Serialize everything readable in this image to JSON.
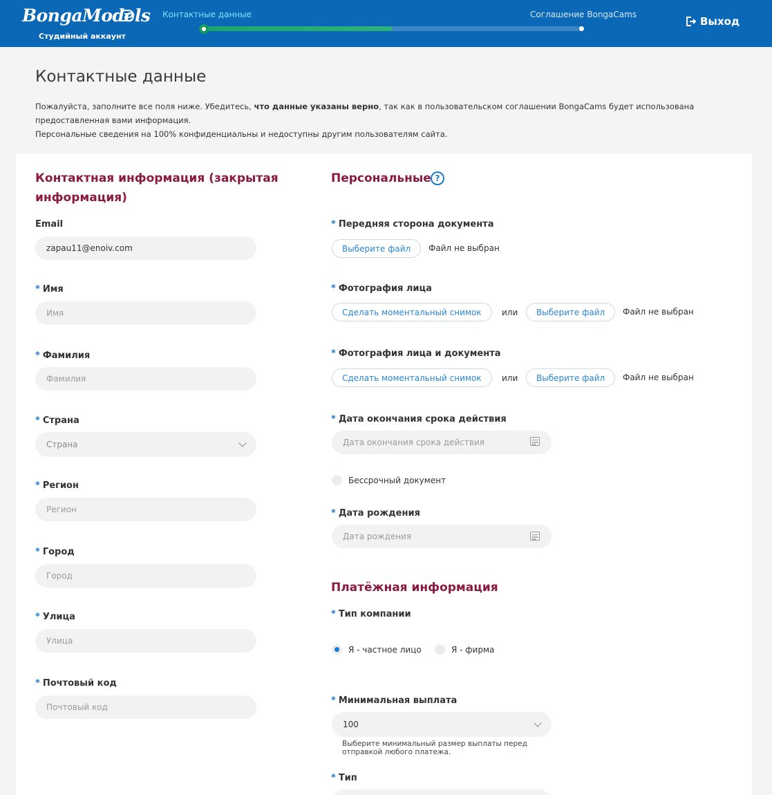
{
  "header": {
    "logo_text": "BongaModels",
    "logo_subtitle": "Студийный аккаунт",
    "step_active": "Контактные данные",
    "step_next": "Соглашение BongaCams",
    "progress_percent": 50,
    "logout_label": "Выход"
  },
  "intro": {
    "title": "Контактные данные",
    "line1_a": "Пожалуйста, заполните все поля ниже. Убедитесь, ",
    "line1_bold": "что данные указаны верно",
    "line1_b": ", так как в пользовательском соглашении BongaCams будет использована предоставленная вами информация.",
    "line2": "Персональные сведения на 100% конфиденциальны и недоступны другим пользователям сайта."
  },
  "contact": {
    "title": "Контактная информация (закрытая информация)",
    "email_label": "Email",
    "email_value": "zapau11@enoiv.com",
    "first_name_label": "Имя",
    "first_name_placeholder": "Имя",
    "last_name_label": "Фамилия",
    "last_name_placeholder": "Фамилия",
    "country_label": "Страна",
    "country_placeholder": "Страна",
    "region_label": "Регион",
    "region_placeholder": "Регион",
    "city_label": "Город",
    "city_placeholder": "Город",
    "street_label": "Улица",
    "street_placeholder": "Улица",
    "zip_label": "Почтовый код",
    "zip_placeholder": "Почтовый код"
  },
  "personal": {
    "title": "Персональные",
    "help_glyph": "?",
    "doc_front_label": "Передняя сторона документа",
    "choose_file": "Выберите файл",
    "no_file": "Файл не выбран",
    "face_photo_label": "Фотография лица",
    "snapshot": "Сделать моментальный снимок",
    "or": "или",
    "face_doc_label": "Фотография лица и документа",
    "expiry_label": "Дата окончания срока действия",
    "expiry_placeholder": "Дата окончания срока действия",
    "perpetual_label": "Бессрочный документ",
    "birth_label": "Дата рождения",
    "birth_placeholder": "Дата рождения"
  },
  "payment": {
    "title": "Платёжная информация",
    "company_type_label": "Тип компании",
    "private_person": "Я - частное лицо",
    "firm": "Я - фирма",
    "min_payout_label": "Минимальная выплата",
    "min_payout_value": "100",
    "min_payout_hint": "Выберите минимальный размер выплаты перед отправкой любого платежа.",
    "type_label": "Тип"
  }
}
